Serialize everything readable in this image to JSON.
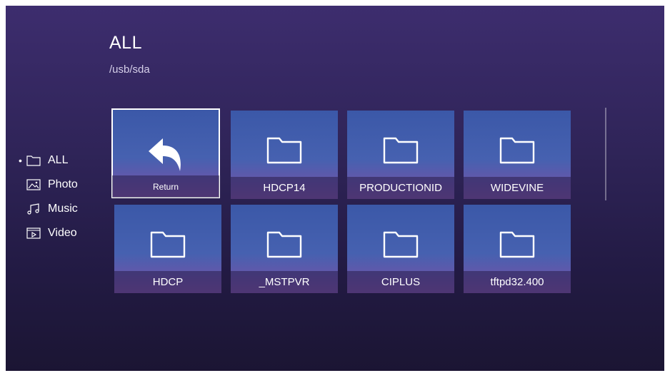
{
  "header": {
    "title": "ALL",
    "path": "/usb/sda"
  },
  "sidebar": {
    "items": [
      {
        "label": "ALL",
        "icon": "folder-icon",
        "active": true
      },
      {
        "label": "Photo",
        "icon": "photo-icon"
      },
      {
        "label": "Music",
        "icon": "music-icon"
      },
      {
        "label": "Video",
        "icon": "video-icon"
      }
    ]
  },
  "grid": {
    "items": [
      {
        "label": "Return",
        "icon": "return-arrow-icon"
      },
      {
        "label": "HDCP14",
        "icon": "folder-icon"
      },
      {
        "label": "PRODUCTIONID",
        "icon": "folder-icon"
      },
      {
        "label": "WIDEVINE",
        "icon": "folder-icon"
      },
      {
        "label": "HDCP",
        "icon": "folder-icon"
      },
      {
        "label": "_MSTPVR",
        "icon": "folder-icon"
      },
      {
        "label": "CIPLUS",
        "icon": "folder-icon"
      },
      {
        "label": "tftpd32.400",
        "icon": "folder-icon"
      }
    ]
  },
  "colors": {
    "background_top": "#3d2d6e",
    "background_bottom": "#1b1533",
    "tile": "#4661b0",
    "selection_border": "#ffffff"
  }
}
